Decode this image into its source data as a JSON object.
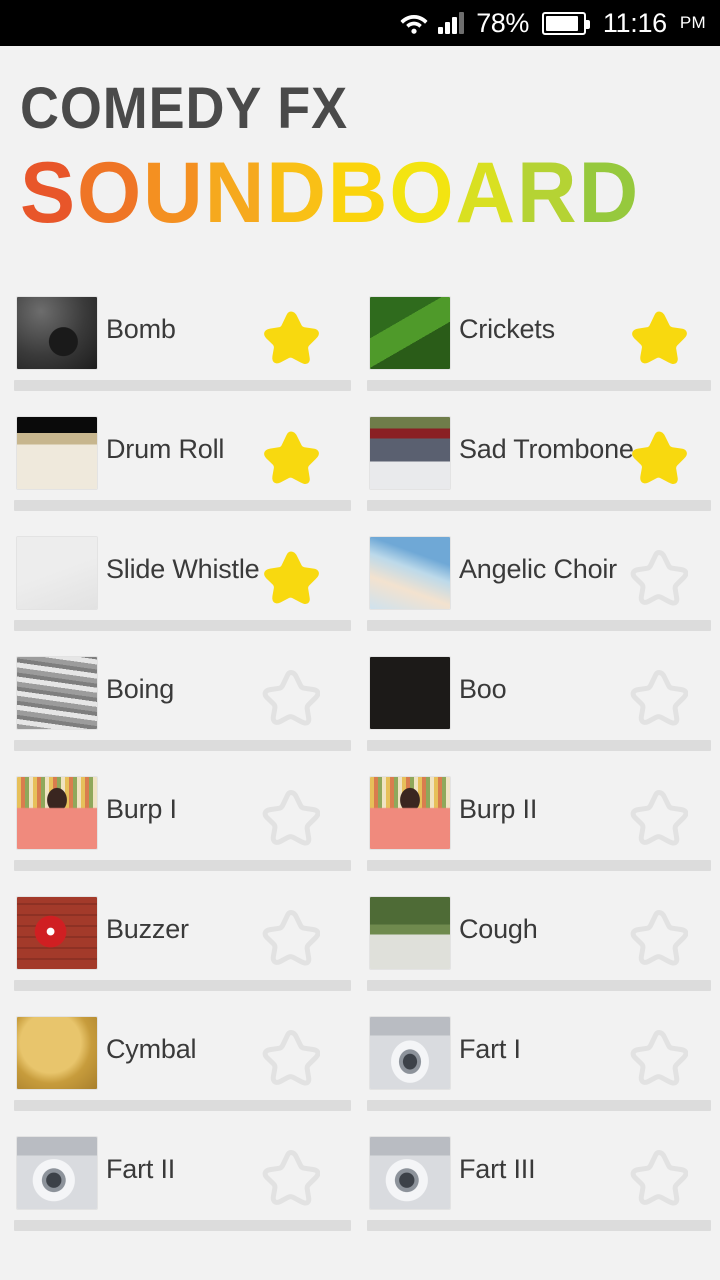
{
  "status_bar": {
    "wifi_icon": "wifi-icon",
    "signal_icon": "cellular-signal-icon",
    "battery_percent": "78%",
    "battery_icon": "battery-icon",
    "time": "11:16",
    "meridiem": "PM"
  },
  "header": {
    "title_top": "COMEDY FX",
    "title_bottom": "SOUNDBOARD",
    "title_top_color": "#4a4a4a",
    "gradient_colors": [
      "#e8562a",
      "#ef7526",
      "#f49021",
      "#f6a91e",
      "#f9c016",
      "#fbd40d",
      "#f3e411",
      "#d9e021",
      "#b5d334",
      "#96c93d",
      "#8dc63f"
    ]
  },
  "theme": {
    "background": "#f2f2f2",
    "label_color": "#3a3a3a",
    "separator_color": "#dcdcdc",
    "star_filled_color": "#f8d90f",
    "star_empty_color": "#e2e2e2"
  },
  "sounds": [
    {
      "name": "Bomb",
      "favorite": true,
      "thumb": "bomb-thumbnail"
    },
    {
      "name": "Crickets",
      "favorite": true,
      "thumb": "crickets-thumbnail"
    },
    {
      "name": "Drum Roll",
      "favorite": true,
      "thumb": "drum-roll-thumbnail"
    },
    {
      "name": "Sad Trombone",
      "favorite": true,
      "thumb": "sad-trombone-thumbnail"
    },
    {
      "name": "Slide Whistle",
      "favorite": true,
      "thumb": "slide-whistle-thumbnail"
    },
    {
      "name": "Angelic Choir",
      "favorite": false,
      "thumb": "angelic-choir-thumbnail"
    },
    {
      "name": "Boing",
      "favorite": false,
      "thumb": "boing-thumbnail"
    },
    {
      "name": "Boo",
      "favorite": false,
      "thumb": "boo-thumbnail"
    },
    {
      "name": "Burp I",
      "favorite": false,
      "thumb": "burp-one-thumbnail"
    },
    {
      "name": "Burp II",
      "favorite": false,
      "thumb": "burp-two-thumbnail"
    },
    {
      "name": "Buzzer",
      "favorite": false,
      "thumb": "buzzer-thumbnail"
    },
    {
      "name": "Cough",
      "favorite": false,
      "thumb": "cough-thumbnail"
    },
    {
      "name": "Cymbal",
      "favorite": false,
      "thumb": "cymbal-thumbnail"
    },
    {
      "name": "Fart I",
      "favorite": false,
      "thumb": "fart-one-thumbnail"
    },
    {
      "name": "Fart II",
      "favorite": false,
      "thumb": "fart-two-thumbnail"
    },
    {
      "name": "Fart III",
      "favorite": false,
      "thumb": "fart-three-thumbnail"
    }
  ]
}
